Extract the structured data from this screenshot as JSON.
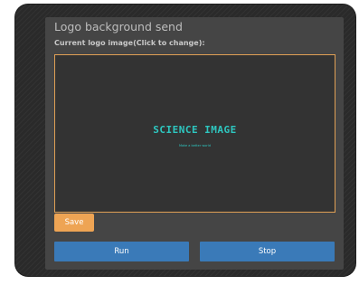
{
  "panel": {
    "title": "Logo background send",
    "subtitle": "Current logo image(Click to change):"
  },
  "logo": {
    "title": "SCIENCE IMAGE",
    "tagline": "Make a better world"
  },
  "buttons": {
    "save": "Save",
    "run": "Run",
    "stop": "Stop"
  },
  "colors": {
    "accent_orange": "#eea454",
    "logo_border": "#e0a055",
    "primary_blue": "#3a7ab8",
    "logo_text_teal": "#2ec7c0",
    "panel_bg": "#454545"
  }
}
